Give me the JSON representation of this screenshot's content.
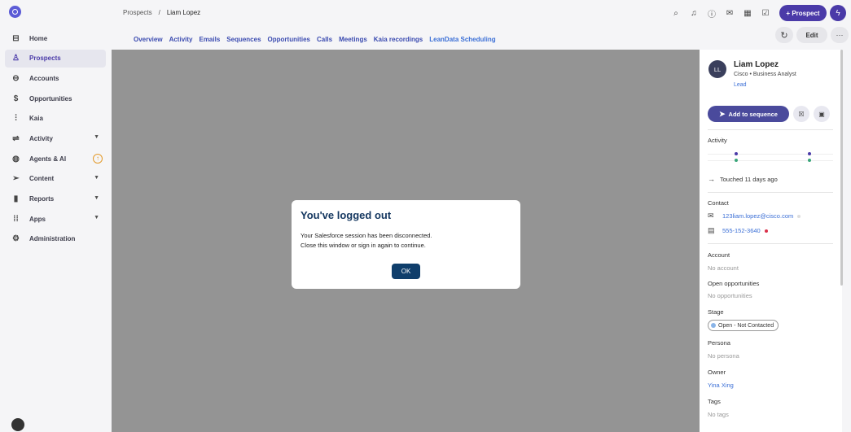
{
  "breadcrumb": {
    "parent": "Prospects",
    "separator": "/",
    "current": "Liam Lopez"
  },
  "top_actions": {
    "prospect_button": "+ Prospect",
    "edit_button": "Edit",
    "more_button": "···"
  },
  "sidebar": {
    "items": [
      {
        "label": "Home",
        "icon": "home-icon",
        "glyph": "⌂",
        "active": false
      },
      {
        "label": "Prospects",
        "icon": "person-icon",
        "glyph": "♙",
        "active": true
      },
      {
        "label": "Accounts",
        "icon": "briefcase-icon",
        "glyph": "▭",
        "active": false
      },
      {
        "label": "Opportunities",
        "icon": "dollar-icon",
        "glyph": "$",
        "active": false
      },
      {
        "label": "Kaia",
        "icon": "waveform-icon",
        "glyph": "⫶",
        "active": false
      },
      {
        "label": "Activity",
        "icon": "activity-icon",
        "glyph": "⇌",
        "active": false,
        "chevron": true
      },
      {
        "label": "Agents & AI",
        "icon": "agent-icon",
        "glyph": "◍",
        "active": false,
        "badge": "↑"
      },
      {
        "label": "Content",
        "icon": "send-icon",
        "glyph": "➢",
        "active": false,
        "chevron": true
      },
      {
        "label": "Reports",
        "icon": "bar-chart-icon",
        "glyph": "▮",
        "active": false,
        "chevron": true
      },
      {
        "label": "Apps",
        "icon": "grid-icon",
        "glyph": "⋮",
        "active": false,
        "chevron": true
      },
      {
        "label": "Administration",
        "icon": "gear-icon",
        "glyph": "⚙",
        "active": false
      }
    ]
  },
  "tabs": [
    "Overview",
    "Activity",
    "Emails",
    "Sequences",
    "Opportunities",
    "Calls",
    "Meetings",
    "Kaia recordings",
    "LeanData Scheduling"
  ],
  "modal": {
    "title": "You've logged out",
    "line1": "Your Salesforce session has been disconnected.",
    "line2": "Close this window or sign in again to continue.",
    "ok": "OK"
  },
  "profile": {
    "initials": "LL",
    "name": "Liam Lopez",
    "title": "Cisco • Business Analyst",
    "type": "Lead",
    "add_to_sequence": "Add to sequence"
  },
  "activity": {
    "label": "Activity",
    "touched": "Touched 11 days ago"
  },
  "contact": {
    "label": "Contact",
    "email": "123liam.lopez@cisco.com",
    "phone": "555-152-3640"
  },
  "details": {
    "account_label": "Account",
    "account_value": "No account",
    "opps_label": "Open opportunities",
    "opps_value": "No opportunities",
    "stage_label": "Stage",
    "stage_value": "Open - Not Contacted",
    "persona_label": "Persona",
    "persona_value": "No persona",
    "owner_label": "Owner",
    "owner_value": "Yina Xing",
    "tags_label": "Tags",
    "tags_value": "No tags"
  },
  "colors": {
    "brand": "#4a3aa8",
    "modal_title": "#13365f",
    "ok_button": "#0f3e6b",
    "overlay": "#949494",
    "link": "#3b6fd6"
  }
}
